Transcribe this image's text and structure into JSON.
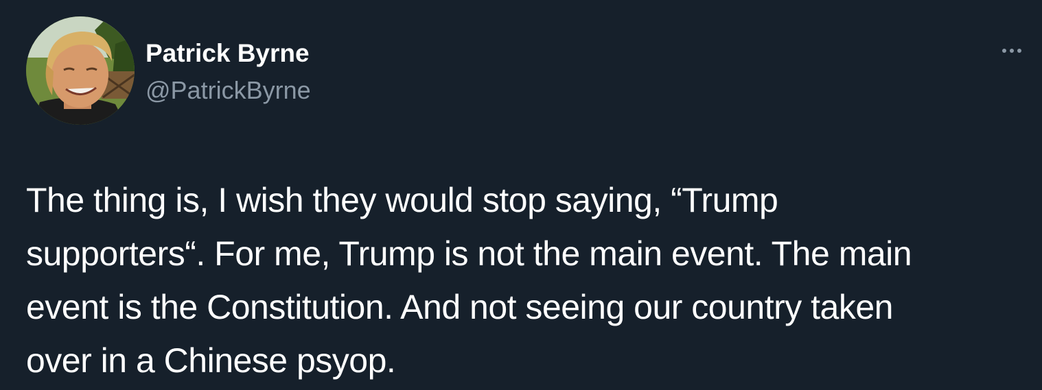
{
  "author": {
    "display_name": "Patrick Byrne",
    "handle": "@PatrickByrne",
    "avatar_icon": "profile-photo"
  },
  "more_icon": "more-horizontal-icon",
  "tweet": {
    "lines": [
      "The thing is, I wish they would stop saying, “Trump",
      "supporters“. For me, Trump is not the main event. The main",
      "event is the Constitution. And not seeing our country taken",
      "over in a Chinese psyop."
    ]
  },
  "colors": {
    "background": "#16202b",
    "primary_text": "#ffffff",
    "secondary_text": "#8b98a5"
  }
}
